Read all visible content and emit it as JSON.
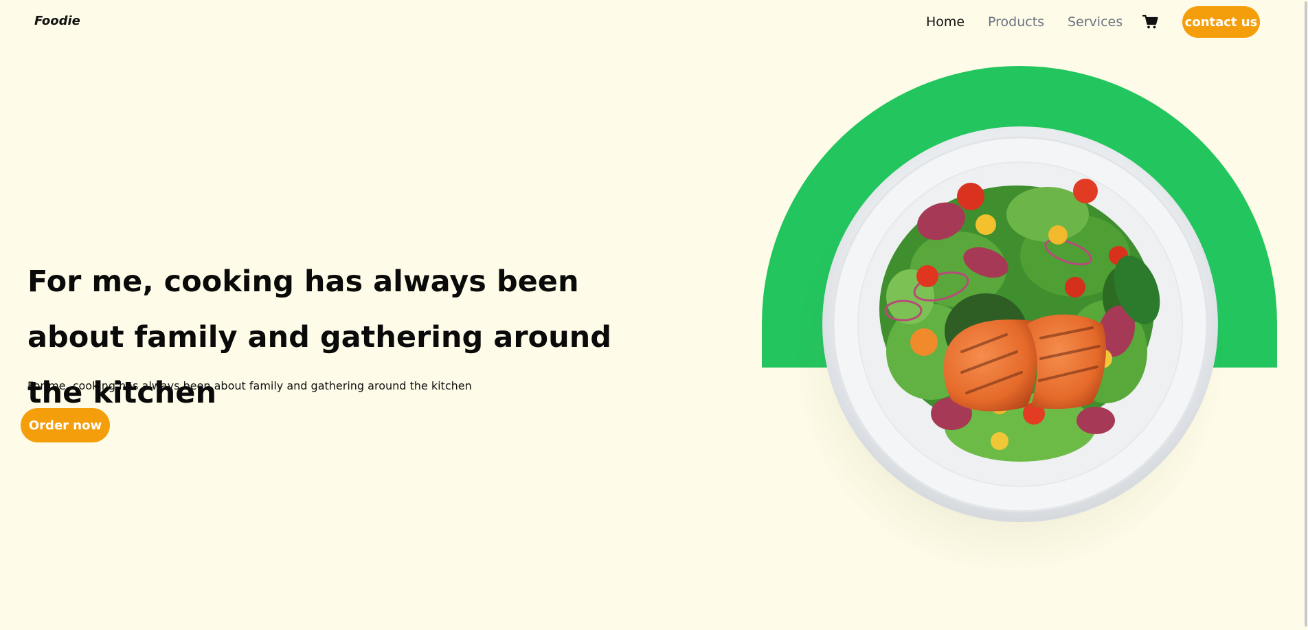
{
  "navbar": {
    "brand": "Foodie",
    "links": [
      {
        "label": "Home",
        "active": true
      },
      {
        "label": "Products",
        "active": false
      },
      {
        "label": "Services",
        "active": false
      }
    ],
    "cart_icon": "cart-icon",
    "contact_label": "contact us"
  },
  "hero": {
    "title": "For me, cooking has always been about family and gathering around the kitchen",
    "subtitle": "For me, cooking has always been about family and gathering around the kitchen",
    "cta_label": "Order now",
    "image": "salad-plate-image"
  },
  "colors": {
    "background": "#fefce8",
    "accent": "#f59e0b",
    "arch": "#22c55e",
    "text": "#0a0a0a",
    "muted": "#6b7280"
  }
}
